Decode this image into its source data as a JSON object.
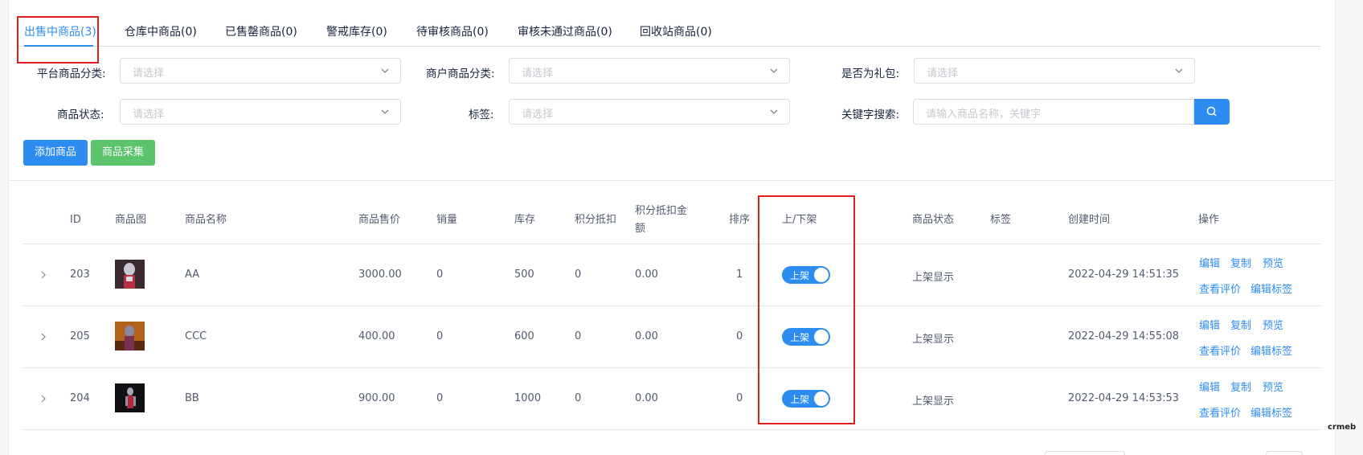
{
  "tabs": [
    {
      "label": "出售中商品(3)"
    },
    {
      "label": "仓库中商品(0)"
    },
    {
      "label": "已售罄商品(0)"
    },
    {
      "label": "警戒库存(0)"
    },
    {
      "label": "待审核商品(0)"
    },
    {
      "label": "审核未通过商品(0)"
    },
    {
      "label": "回收站商品(0)"
    }
  ],
  "filters": {
    "platform_category": {
      "label": "平台商品分类:",
      "placeholder": "请选择"
    },
    "merchant_category": {
      "label": "商户商品分类:",
      "placeholder": "请选择"
    },
    "is_gift": {
      "label": "是否为礼包:",
      "placeholder": "请选择"
    },
    "status": {
      "label": "商品状态:",
      "placeholder": "请选择"
    },
    "tag": {
      "label": "标签:",
      "placeholder": "请选择"
    },
    "keyword": {
      "label": "关键字搜索:",
      "placeholder": "请输入商品名称，关键字"
    }
  },
  "actions": {
    "add": "添加商品",
    "collect": "商品采集"
  },
  "colors": {
    "primary": "#2d8cf0",
    "success": "#5cc46b",
    "highlight": "#e02020"
  },
  "table": {
    "headers": {
      "id": "ID",
      "image": "商品图",
      "name": "商品名称",
      "price": "商品售价",
      "sales": "销量",
      "stock": "库存",
      "points": "积分抵扣",
      "points_amount_1": "积分抵扣金",
      "points_amount_2": "额",
      "sort": "排序",
      "shelf": "上/下架",
      "status": "商品状态",
      "tag": "标签",
      "created": "创建时间",
      "ops": "操作"
    },
    "rows": [
      {
        "id": "203",
        "name": "AA",
        "price": "3000.00",
        "sales": "0",
        "stock": "500",
        "points": "0",
        "points_amount": "0.00",
        "sort": "1",
        "shelf": "上架",
        "status": "上架显示",
        "created": "2022-04-29 14:51:35"
      },
      {
        "id": "205",
        "name": "CCC",
        "price": "400.00",
        "sales": "0",
        "stock": "600",
        "points": "0",
        "points_amount": "0.00",
        "sort": "0",
        "shelf": "上架",
        "status": "上架显示",
        "created": "2022-04-29 14:55:08"
      },
      {
        "id": "204",
        "name": "BB",
        "price": "900.00",
        "sales": "0",
        "stock": "1000",
        "points": "0",
        "points_amount": "0.00",
        "sort": "0",
        "shelf": "上架",
        "status": "上架显示",
        "created": "2022-04-29 14:53:53"
      }
    ],
    "ops": {
      "edit": "编辑",
      "copy": "复制",
      "preview": "预览",
      "reviews": "查看评价",
      "edit_tags": "编辑标签"
    }
  },
  "brand": "crmeb"
}
